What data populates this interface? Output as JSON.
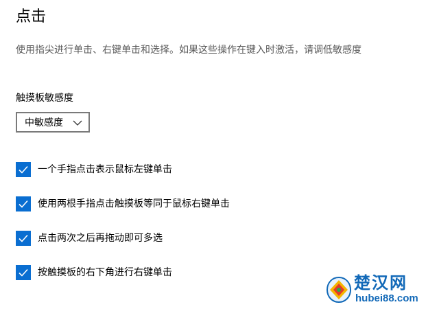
{
  "section": {
    "title": "点击",
    "description": "使用指尖进行单击、右键单击和选择。如果这些操作在键入时激活，请调低敏感度"
  },
  "sensitivity": {
    "label": "触摸板敏感度",
    "selected": "中敏感度"
  },
  "options": [
    {
      "label": "一个手指点击表示鼠标左键单击",
      "checked": true
    },
    {
      "label": "使用两根手指点击触摸板等同于鼠标右键单击",
      "checked": true
    },
    {
      "label": "点击两次之后再拖动即可多选",
      "checked": true
    },
    {
      "label": "按触摸板的右下角进行右键单击",
      "checked": true
    }
  ],
  "watermark": {
    "title": "楚汉网",
    "url": "hubei88.com"
  },
  "colors": {
    "accent": "#0a6ed1",
    "description_text": "#5a5a5a",
    "watermark": "#1269b8"
  }
}
